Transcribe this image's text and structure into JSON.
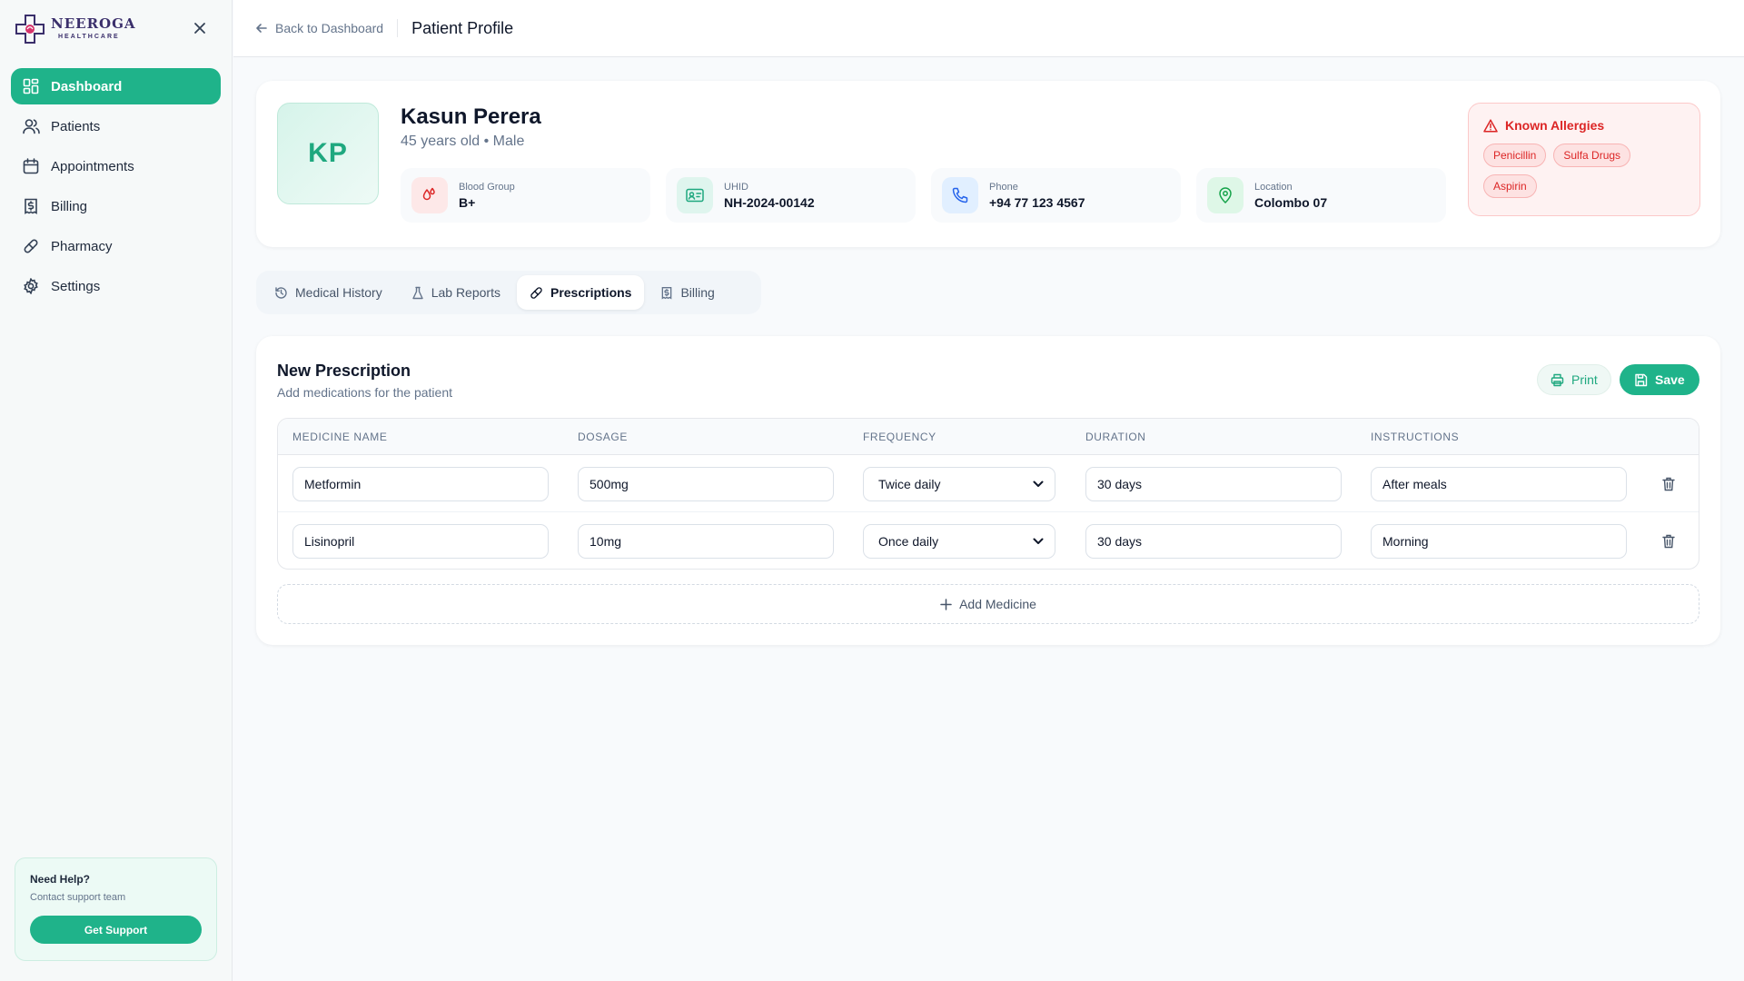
{
  "brand": {
    "name": "NEEROGA",
    "sub": "HEALTHCARE"
  },
  "sidebar": {
    "items": [
      {
        "label": "Dashboard",
        "icon": "dashboard-icon",
        "active": true
      },
      {
        "label": "Patients",
        "icon": "users-icon"
      },
      {
        "label": "Appointments",
        "icon": "calendar-icon"
      },
      {
        "label": "Billing",
        "icon": "receipt-icon"
      },
      {
        "label": "Pharmacy",
        "icon": "pill-icon"
      },
      {
        "label": "Settings",
        "icon": "gear-icon"
      }
    ],
    "help": {
      "title": "Need Help?",
      "subtitle": "Contact support team",
      "button": "Get Support"
    }
  },
  "topbar": {
    "back_label": "Back to Dashboard",
    "title": "Patient Profile"
  },
  "patient": {
    "initials": "KP",
    "name": "Kasun Perera",
    "meta": "45 years old • Male",
    "info": [
      {
        "label": "Blood Group",
        "value": "B+",
        "icon": "droplet-icon"
      },
      {
        "label": "UHID",
        "value": "NH-2024-00142",
        "icon": "id-card-icon"
      },
      {
        "label": "Phone",
        "value": "+94 77 123 4567",
        "icon": "phone-icon"
      },
      {
        "label": "Location",
        "value": "Colombo 07",
        "icon": "map-pin-icon"
      }
    ],
    "allergies": {
      "title": "Known Allergies",
      "items": [
        "Penicillin",
        "Sulfa Drugs",
        "Aspirin"
      ]
    }
  },
  "tabs": [
    {
      "label": "Medical History",
      "icon": "history-icon"
    },
    {
      "label": "Lab Reports",
      "icon": "flask-icon"
    },
    {
      "label": "Prescriptions",
      "icon": "pill-icon",
      "active": true
    },
    {
      "label": "Billing",
      "icon": "receipt-icon"
    }
  ],
  "prescription": {
    "title": "New Prescription",
    "subtitle": "Add medications for the patient",
    "print_label": "Print",
    "save_label": "Save",
    "columns": [
      "MEDICINE NAME",
      "DOSAGE",
      "FREQUENCY",
      "DURATION",
      "INSTRUCTIONS"
    ],
    "rows": [
      {
        "medicine": "Metformin",
        "dosage": "500mg",
        "frequency": "Twice daily",
        "duration": "30 days",
        "instructions": "After meals"
      },
      {
        "medicine": "Lisinopril",
        "dosage": "10mg",
        "frequency": "Once daily",
        "duration": "30 days",
        "instructions": "Morning"
      }
    ],
    "add_label": "Add Medicine"
  },
  "colors": {
    "accent": "#1fb38a",
    "danger": "#dc2626"
  }
}
